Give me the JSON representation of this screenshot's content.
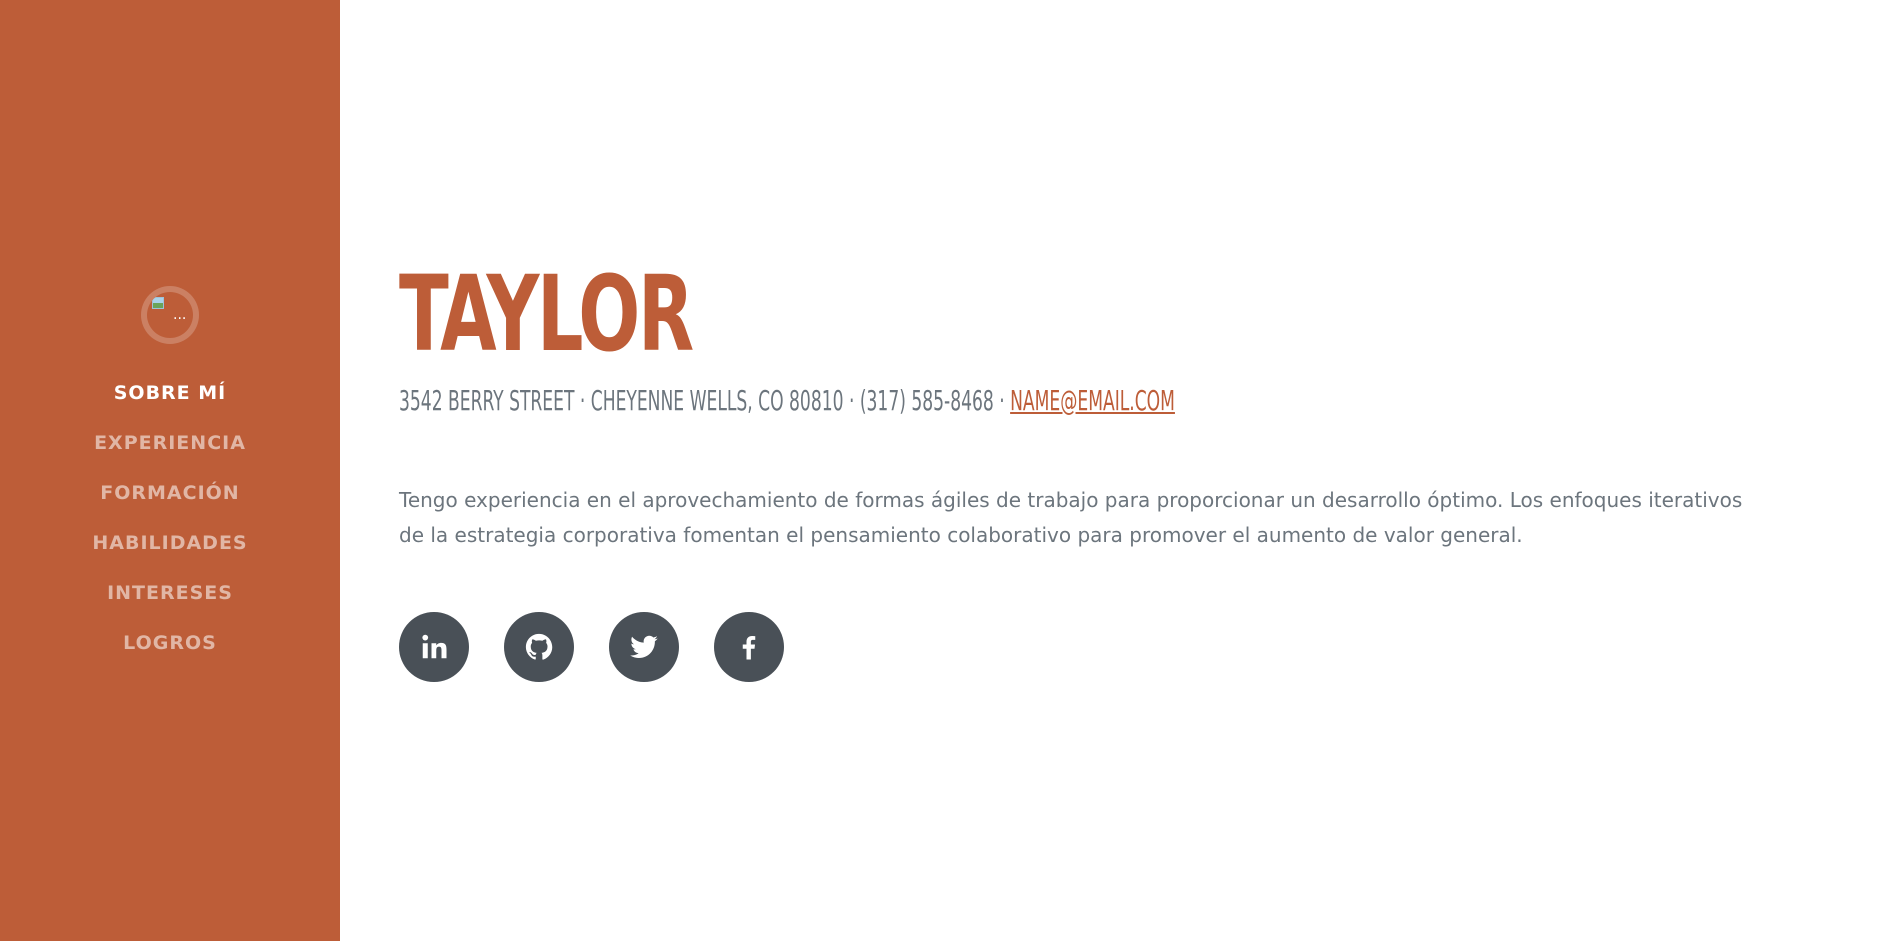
{
  "sidebar": {
    "avatar_alt": "...",
    "nav": [
      {
        "label": "SOBRE MÍ",
        "active": true
      },
      {
        "label": "EXPERIENCIA",
        "active": false
      },
      {
        "label": "FORMACIÓN",
        "active": false
      },
      {
        "label": "HABILIDADES",
        "active": false
      },
      {
        "label": "INTERESES",
        "active": false
      },
      {
        "label": "LOGROS",
        "active": false
      }
    ],
    "background_color": "#bd5d38"
  },
  "about": {
    "name": "TAYLOR",
    "address": "3542 BERRY STREET · CHEYENNE WELLS, CO 80810 · (317) 585-8468 · ",
    "email": "NAME@EMAIL.COM",
    "bio": "Tengo experiencia en el aprovechamiento de formas ágiles de trabajo para proporcionar un desarrollo óptimo. Los enfoques iterativos de la estrategia corporativa fomentan el pensamiento colaborativo para promover el aumento de valor general."
  },
  "social": [
    {
      "name": "linkedin",
      "icon": "linkedin-icon"
    },
    {
      "name": "github",
      "icon": "github-icon"
    },
    {
      "name": "twitter",
      "icon": "twitter-icon"
    },
    {
      "name": "facebook",
      "icon": "facebook-icon"
    }
  ],
  "colors": {
    "accent": "#bd5d38",
    "text_muted": "#6c757d",
    "social_bg": "#495057"
  }
}
